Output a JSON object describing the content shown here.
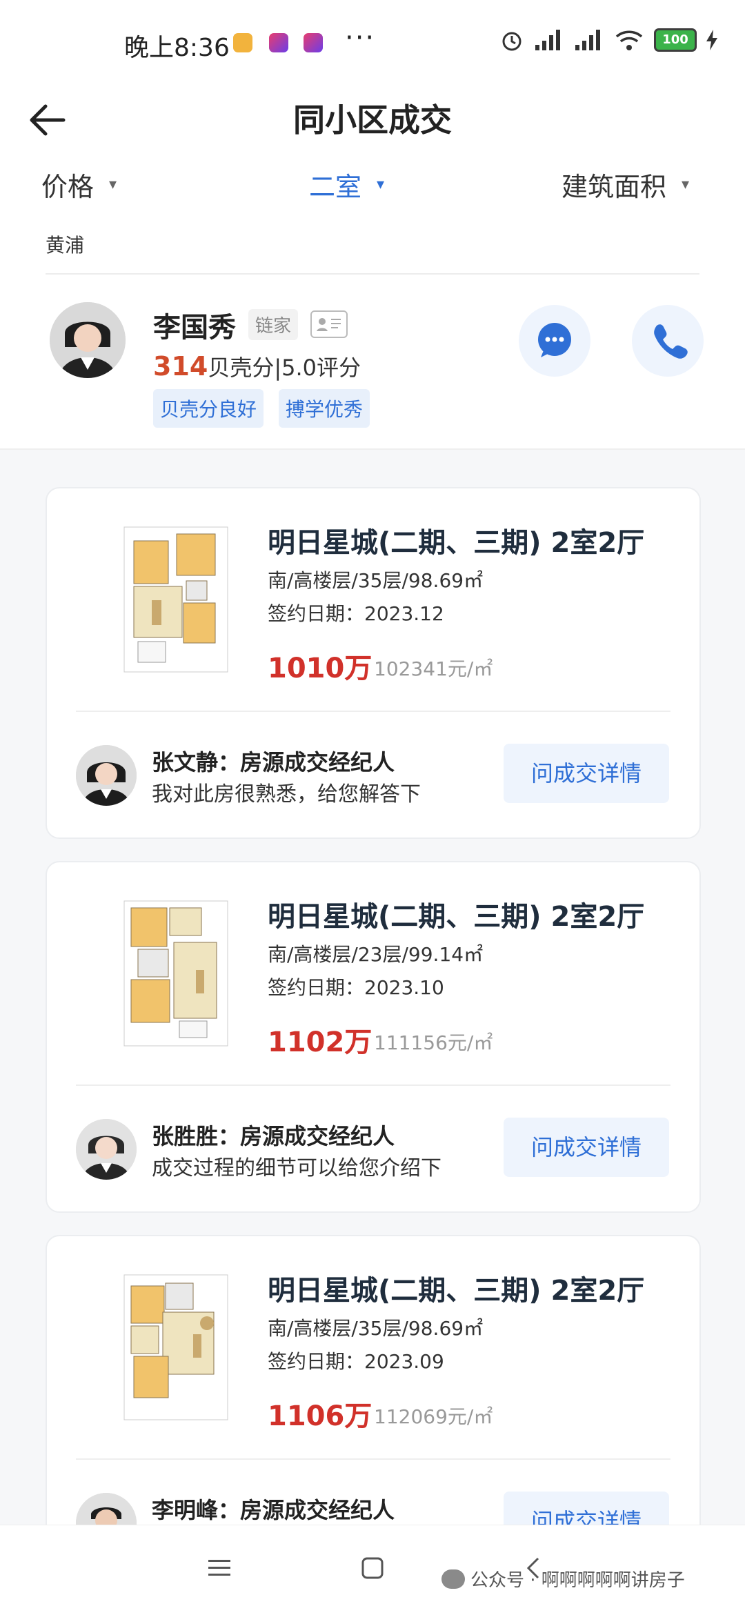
{
  "status_bar": {
    "time": "晚上8:36",
    "battery": "100",
    "app_icon_colors": [
      "#f2b33d",
      "#e83d6e",
      "#e83d6e"
    ]
  },
  "header": {
    "title": "同小区成交",
    "back_icon": "arrow-left-icon"
  },
  "filters": [
    {
      "label": "价格",
      "active": false
    },
    {
      "label": "二室",
      "active": true
    },
    {
      "label": "建筑面积",
      "active": false
    }
  ],
  "district": "黄浦",
  "agent": {
    "name": "李国秀",
    "brand": "链家",
    "score": "314",
    "score_text": "贝壳分|5.0评分",
    "tags": [
      "贝壳分良好",
      "搏学优秀"
    ],
    "chat_icon": "chat-icon",
    "phone_icon": "phone-icon"
  },
  "listings": [
    {
      "title": "明日星城(二期、三期) 2室2厅",
      "meta": "南/高楼层/35层/98.69㎡",
      "date": "签约日期：2023.12",
      "price": "1010万",
      "unit_price": "102341元/㎡",
      "agent_name": "张文静：房源成交经纪人",
      "agent_desc": "我对此房很熟悉，给您解答下",
      "button": "问成交详情"
    },
    {
      "title": "明日星城(二期、三期) 2室2厅",
      "meta": "南/高楼层/23层/99.14㎡",
      "date": "签约日期：2023.10",
      "price": "1102万",
      "unit_price": "111156元/㎡",
      "agent_name": "张胜胜：房源成交经纪人",
      "agent_desc": "成交过程的细节可以给您介绍下",
      "button": "问成交详情"
    },
    {
      "title": "明日星城(二期、三期) 2室2厅",
      "meta": "南/高楼层/35层/98.69㎡",
      "date": "签约日期：2023.09",
      "price": "1106万",
      "unit_price": "112069元/㎡",
      "agent_name": "李明峰：房源成交经纪人",
      "agent_desc": "",
      "button": "问成交详情"
    }
  ],
  "watermark": "公众号 · 啊啊啊啊啊讲房子",
  "colors": {
    "accent": "#2f6fd6",
    "price": "#d1312a",
    "score": "#d14b2a"
  }
}
